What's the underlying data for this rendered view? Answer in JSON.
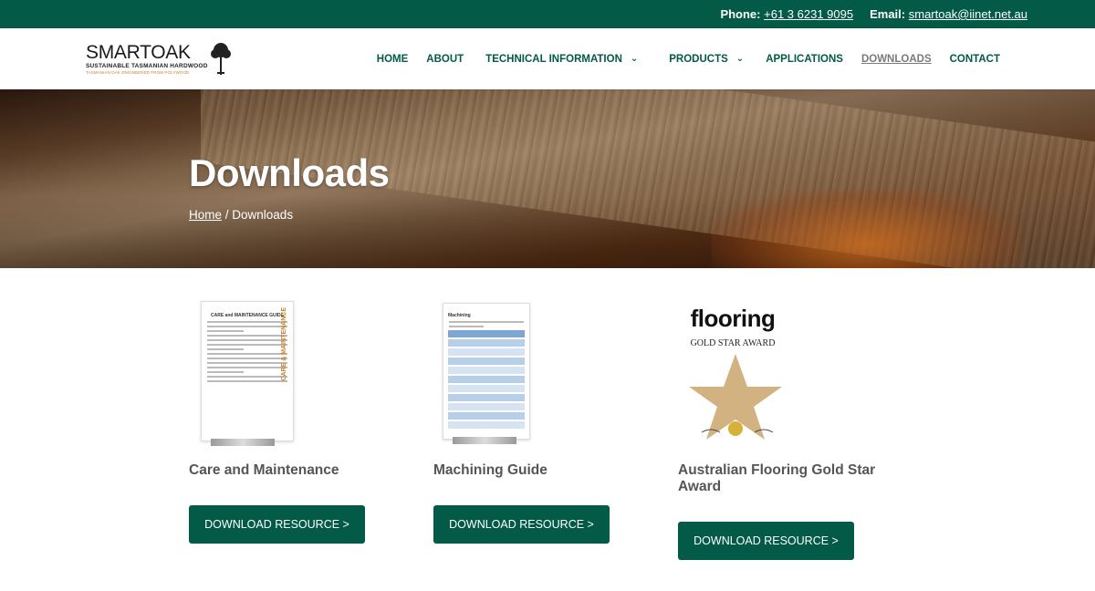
{
  "topbar": {
    "phone_label": "Phone:",
    "phone": "+61 3 6231 9095",
    "email_label": "Email:",
    "email": "smartoak@iinet.net.au"
  },
  "logo": {
    "name_a": "SMART",
    "name_b": "OAK",
    "subtitle": "SUSTAINABLE TASMANIAN HARDWOOD",
    "tagline": "TASMANIAN OAK ENGINEERED FROM POLYWOOD"
  },
  "nav": {
    "items": [
      {
        "label": "HOME"
      },
      {
        "label": "ABOUT"
      },
      {
        "label": "TECHNICAL INFORMATION"
      },
      {
        "label": "PRODUCTS"
      },
      {
        "label": "APPLICATIONS"
      },
      {
        "label": "DOWNLOADS"
      },
      {
        "label": "CONTACT"
      }
    ]
  },
  "hero": {
    "title": "Downloads",
    "breadcrumb_home": "Home",
    "breadcrumb_sep": " / ",
    "breadcrumb_current": "Downloads"
  },
  "resources": [
    {
      "title": "Care and Maintenance",
      "button": "DOWNLOAD RESOURCE >",
      "thumb_heading": "CARE and MAINTENANCE GUIDE",
      "thumb_side": "CARE & MAINTENANCE"
    },
    {
      "title": "Machining Guide",
      "button": "DOWNLOAD RESOURCE >",
      "thumb_heading": "Machining"
    },
    {
      "title": "Australian Flooring Gold Star Award",
      "button": "DOWNLOAD RESOURCE >",
      "thumb_brand": "flooring",
      "thumb_award": "GOLD STAR AWARD"
    }
  ],
  "colors": {
    "brand_green": "#025a47",
    "accent_orange": "#c8822a"
  }
}
